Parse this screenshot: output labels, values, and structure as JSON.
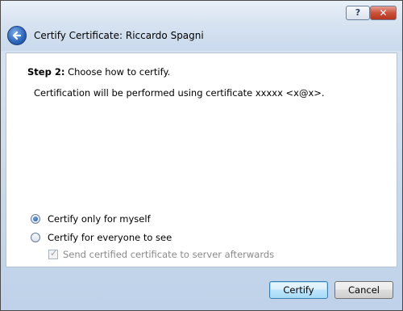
{
  "window": {
    "title": "Certify Certificate: Riccardo Spagni",
    "help_label": "?",
    "close_label": "✕"
  },
  "step": {
    "label": "Step 2:",
    "text": " Choose how to certify."
  },
  "info_text": "Certification will be performed using certificate xxxxx <x@x>.",
  "options": {
    "myself": {
      "label": "Certify only for myself",
      "selected": true
    },
    "everyone": {
      "label": "Certify for everyone to see",
      "selected": false
    }
  },
  "send_checkbox": {
    "label": "Send certified certificate to server afterwards",
    "checked": true,
    "enabled": false
  },
  "buttons": {
    "certify": "Certify",
    "cancel": "Cancel"
  }
}
